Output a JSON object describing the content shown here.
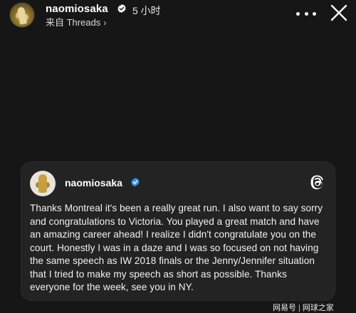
{
  "header": {
    "username": "naomiosaka",
    "time_ago": "5 小时",
    "source_label": "来自 Threads",
    "source_chevron": "›"
  },
  "post": {
    "username": "naomiosaka",
    "text": "Thanks Montreal it's been a really great run. I also want to say sorry and congratulations to Victoria. You played a great match and have an amazing career ahead! I realize I didn't congratulate you on the court. Honestly I was in a daze and I was so focused on not having the same speech as IW 2018 finals or the Jenny/Jennifer situation that I tried to make my speech as short as possible. Thanks everyone for the week, see you in NY."
  },
  "watermark": {
    "left": "网易号",
    "separator": "|",
    "right": "网球之家"
  },
  "icons": {
    "verified": "verified-badge-icon",
    "more": "more-dots-icon",
    "close": "close-icon",
    "threads": "threads-logo-icon"
  },
  "colors": {
    "background": "#161616",
    "card": "#232323",
    "verified_blue": "#3897f0",
    "text": "#ffffff"
  }
}
